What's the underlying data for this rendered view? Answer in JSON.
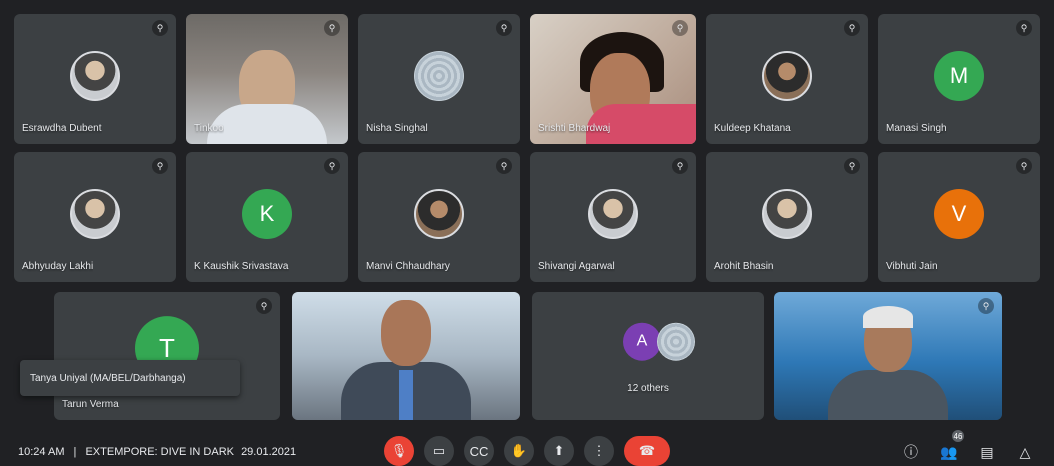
{
  "participants": [
    {
      "name": "Esrawdha Dubent",
      "kind": "photo"
    },
    {
      "name": "Tinkoo",
      "kind": "video"
    },
    {
      "name": "Nisha Singhal",
      "kind": "pattern"
    },
    {
      "name": "Srishti Bhardwaj",
      "kind": "video"
    },
    {
      "name": "Kuldeep Khatana",
      "kind": "photo2"
    },
    {
      "name": "Manasi Singh",
      "kind": "letter",
      "letter": "M",
      "color": "#34a853"
    },
    {
      "name": "Abhyuday Lakhi",
      "kind": "photo"
    },
    {
      "name": "K Kaushik Srivastava",
      "kind": "letter",
      "letter": "K",
      "color": "#34a853"
    },
    {
      "name": "Manvi Chhaudhary",
      "kind": "photo2"
    },
    {
      "name": "Shivangi Agarwal",
      "kind": "photo"
    },
    {
      "name": "Arohit Bhasin",
      "kind": "photo"
    },
    {
      "name": "Vibhuti Jain",
      "kind": "letter",
      "letter": "V",
      "color": "#e8710a"
    },
    {
      "name": "Tarun Verma",
      "kind": "letter",
      "letter": "T",
      "color": "#34a853"
    },
    {
      "name": "",
      "kind": "video"
    },
    {
      "name": "12 others",
      "kind": "group",
      "letter": "A"
    },
    {
      "name": "",
      "kind": "video"
    }
  ],
  "tooltip": "Tanya Uniyal (MA/BEL/Darbhanga)",
  "meeting": {
    "time": "10:24 AM",
    "separator": "|",
    "title": "EXTEMPORE: DIVE IN DARK",
    "date": "29.01.2021"
  },
  "controls": [
    "mic-off",
    "camera",
    "captions",
    "raise-hand",
    "present",
    "more",
    "end-call"
  ],
  "right_controls": [
    "info",
    "people",
    "chat",
    "activities"
  ],
  "badge": "46"
}
